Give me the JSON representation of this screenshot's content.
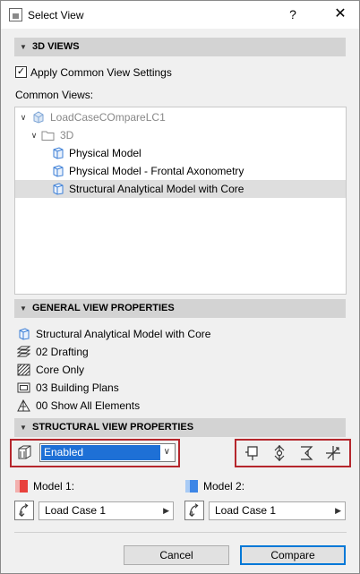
{
  "window": {
    "title": "Select View",
    "help_glyph": "?",
    "close_glyph": "✕"
  },
  "views3d": {
    "header": "3D VIEWS",
    "apply_common_label": "Apply Common View Settings",
    "apply_common_checked": true,
    "common_views_label": "Common Views:",
    "tree": [
      {
        "label": "LoadCaseCOmpareLC1",
        "icon": "project-icon",
        "expanded": true
      },
      {
        "label": "3D",
        "icon": "folder-icon",
        "expanded": true
      },
      {
        "label": "Physical Model",
        "icon": "3d-view-icon"
      },
      {
        "label": "Physical Model - Frontal Axonometry",
        "icon": "3d-view-icon"
      },
      {
        "label": "Structural Analytical Model with Core",
        "icon": "3d-view-icon",
        "selected": true
      }
    ]
  },
  "general": {
    "header": "GENERAL VIEW PROPERTIES",
    "items": [
      {
        "label": "Structural Analytical Model with Core",
        "icon": "view-icon"
      },
      {
        "label": "02 Drafting",
        "icon": "layer-combination-icon"
      },
      {
        "label": "Core Only",
        "icon": "structural-display-icon"
      },
      {
        "label": "03 Building Plans",
        "icon": "model-view-options-icon"
      },
      {
        "label": "00 Show All Elements",
        "icon": "renovation-filter-icon"
      }
    ]
  },
  "structural": {
    "header": "STRUCTURAL VIEW PROPERTIES",
    "mode_value": "Enabled",
    "model1": {
      "label": "Model 1:",
      "color": "#e8413c",
      "load_case": "Load Case 1"
    },
    "model2": {
      "label": "Model 2:",
      "color": "#3d86e6",
      "load_case": "Load Case 1"
    }
  },
  "buttons": {
    "cancel": "Cancel",
    "compare": "Compare"
  },
  "colors": {
    "accent": "#1e70d6",
    "highlight_border": "#b5262c"
  }
}
